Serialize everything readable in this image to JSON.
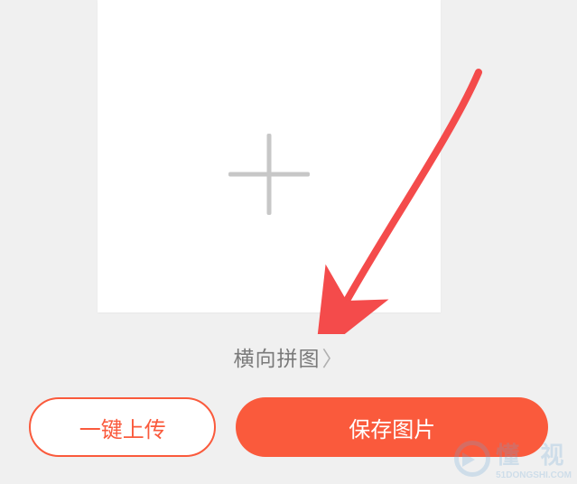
{
  "upload_area": {
    "icon": "plus-icon"
  },
  "mode_link": {
    "label": "横向拼图",
    "chevron": "〉"
  },
  "buttons": {
    "upload_label": "一键上传",
    "save_label": "保存图片"
  },
  "colors": {
    "accent": "#fa5a3c",
    "muted": "#c7c7c7",
    "text_secondary": "#7a7a7a"
  },
  "watermark": {
    "text_1": "懂 视",
    "text_2": "51DONGSHI.COM"
  }
}
